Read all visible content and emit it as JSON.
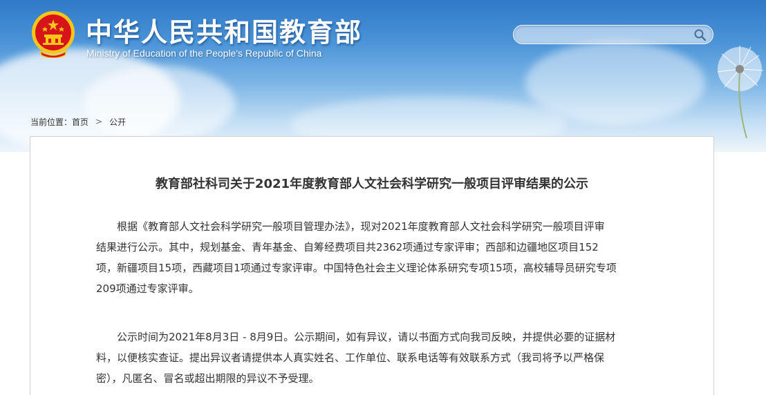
{
  "header": {
    "title": "中华人民共和国教育部",
    "subtitle": "Ministry of Education of the People's Republic of China",
    "emblem_icon": "national-emblem-icon"
  },
  "search": {
    "placeholder": "",
    "icon": "search-icon"
  },
  "breadcrumb": {
    "prefix": "当前位置：",
    "home": "首页",
    "separator": ">",
    "current": "公开"
  },
  "article": {
    "title": "教育部社科司关于2021年度教育部人文社会科学研究一般项目评审结果的公示",
    "paragraph1": [
      "根据《教育部人文社会科学研究一般项目管理办法》，现对2021年度教育部人文社会科学研究一般项目评审",
      "结果进行公示。其中，规划基金、青年基金、自筹经费项目共2362项通过专家评审；西部和边疆地区项目152",
      "项，新疆项目15项，西藏项目1项通过专家评审。中国特色社会主义理论体系研究专项15项，高校辅导员研究专项",
      "209项通过专家评审。"
    ],
    "paragraph2": [
      "公示时间为2021年8月3日 - 8月9日。公示期间，如有异议，请以书面方式向我司反映，并提供必要的证据材",
      "料，以便核实查证。提出异议者请提供本人真实姓名、工作单位、联系电话等有效联系方式（我司将予以严格保",
      "密），凡匿名、冒名或超出期限的异议不予受理。"
    ]
  },
  "colors": {
    "banner_top": "#2f79c8",
    "text": "#333333",
    "border": "#cfcfcf",
    "emblem_red": "#d7141a",
    "emblem_gold": "#f5c518"
  }
}
